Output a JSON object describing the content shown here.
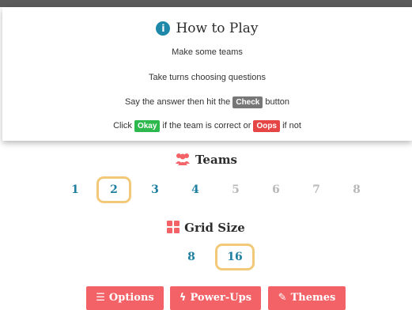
{
  "howto": {
    "title": "How to Play",
    "line1": "Make some teams",
    "line2": "Take turns choosing questions",
    "line3_before": "Say the answer then hit the",
    "line3_tag": "Check",
    "line3_after": "button",
    "line4_before": "Click",
    "line4_tag1": "Okay",
    "line4_middle": "if the team is correct or",
    "line4_tag2": "Oops",
    "line4_after": "if not"
  },
  "teams": {
    "title": "Teams",
    "options": [
      "1",
      "2",
      "3",
      "4",
      "5",
      "6",
      "7",
      "8"
    ],
    "selected": "2"
  },
  "grid": {
    "title": "Grid Size",
    "options": [
      "8",
      "16"
    ],
    "selected": "16"
  },
  "buttons": {
    "options": "Options",
    "powerups": "Power-Ups",
    "themes": "Themes"
  },
  "colors": {
    "accent_button": "#f26266",
    "active_number": "#1e7fa0",
    "inactive_number": "#b9b9b9",
    "selection_ring": "#f2c978",
    "check_tag": "#777777",
    "okay_tag": "#2db84d",
    "oops_tag": "#e64545"
  }
}
